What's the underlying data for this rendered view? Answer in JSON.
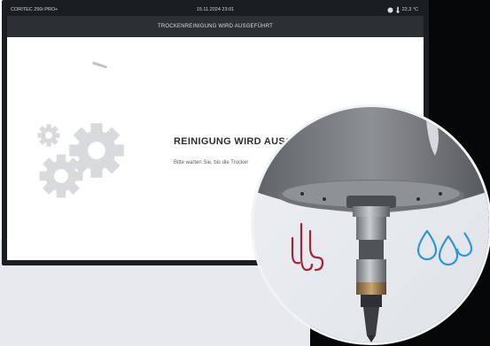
{
  "status_bar": {
    "device": "CORITEC 250i PRO+",
    "datetime": "15.11.2024 23:01",
    "temperature": "22,3 °C"
  },
  "header": {
    "title": "TROCKENREINIGUNG WIRD AUSGEFÜHRT"
  },
  "main": {
    "heading": "REINIGUNG WIRD AUSG",
    "message": "Bitte warten Sie, bis die Trocker"
  },
  "icons": {
    "gears": "gears-icon",
    "air": "air-flow-icon",
    "water": "water-drops-icon",
    "status_dot": "status-dot-icon",
    "thermometer": "thermometer-icon"
  },
  "colors": {
    "air": "#a3243a",
    "water": "#2f95d8",
    "gear": "#d8dadd",
    "header_bg": "#2c3035"
  }
}
